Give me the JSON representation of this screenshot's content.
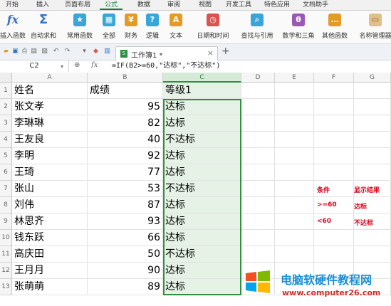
{
  "menu_tabs": [
    "开始",
    "插入",
    "页面布局",
    "公式",
    "数据",
    "审阅",
    "视图",
    "开发工具",
    "特色应用",
    "文档助手"
  ],
  "active_tab": "公式",
  "ribbon": {
    "insert_function": "插入函数",
    "autosum": "自动求和",
    "common_functions": "常用函数",
    "all": "全部",
    "finance": "财务",
    "logic": "逻辑",
    "text": "文本",
    "datetime": "日期和时间",
    "lookup": "查找与引用",
    "math": "数学和三角",
    "other": "其他函数",
    "name_manager": "名称管理器"
  },
  "doc_tab": {
    "label": "工作簿1 *"
  },
  "formula_bar": {
    "cell_ref": "C2",
    "fx": "fx",
    "formula": "=IF(B2>=60,\"达标\",\"不达标\")"
  },
  "columns": [
    "A",
    "B",
    "C",
    "D",
    "E",
    "F",
    "G"
  ],
  "row_numbers": [
    "1",
    "2",
    "3",
    "4",
    "5",
    "6",
    "7",
    "8",
    "9",
    "10",
    "11",
    "12",
    "13"
  ],
  "table": {
    "headers": [
      "姓名",
      "成绩",
      "等级1"
    ],
    "rows": [
      [
        "张文孝",
        "95",
        "达标"
      ],
      [
        "李琳琳",
        "82",
        "达标"
      ],
      [
        "王友良",
        "40",
        "不达标"
      ],
      [
        "李明",
        "92",
        "达标"
      ],
      [
        "王琦",
        "77",
        "达标"
      ],
      [
        "张山",
        "53",
        "不达标"
      ],
      [
        "刘伟",
        "87",
        "达标"
      ],
      [
        "林思齐",
        "93",
        "达标"
      ],
      [
        "钱东跃",
        "66",
        "达标"
      ],
      [
        "高庆田",
        "50",
        "不达标"
      ],
      [
        "王月月",
        "90",
        "达标"
      ],
      [
        "张萌萌",
        "89",
        "达标"
      ]
    ]
  },
  "conditions": {
    "header": [
      "条件",
      "显示结果"
    ],
    "rows": [
      [
        ">=60",
        "达标"
      ],
      [
        "<60",
        "不达标"
      ]
    ]
  },
  "watermark": {
    "title": "电脑软硬件教程网",
    "url": "www.computer26.com"
  },
  "colors": {
    "accent_green": "#2f8f3f",
    "condition_red": "#e0001a",
    "watermark_blue": "#1a8fd6"
  }
}
